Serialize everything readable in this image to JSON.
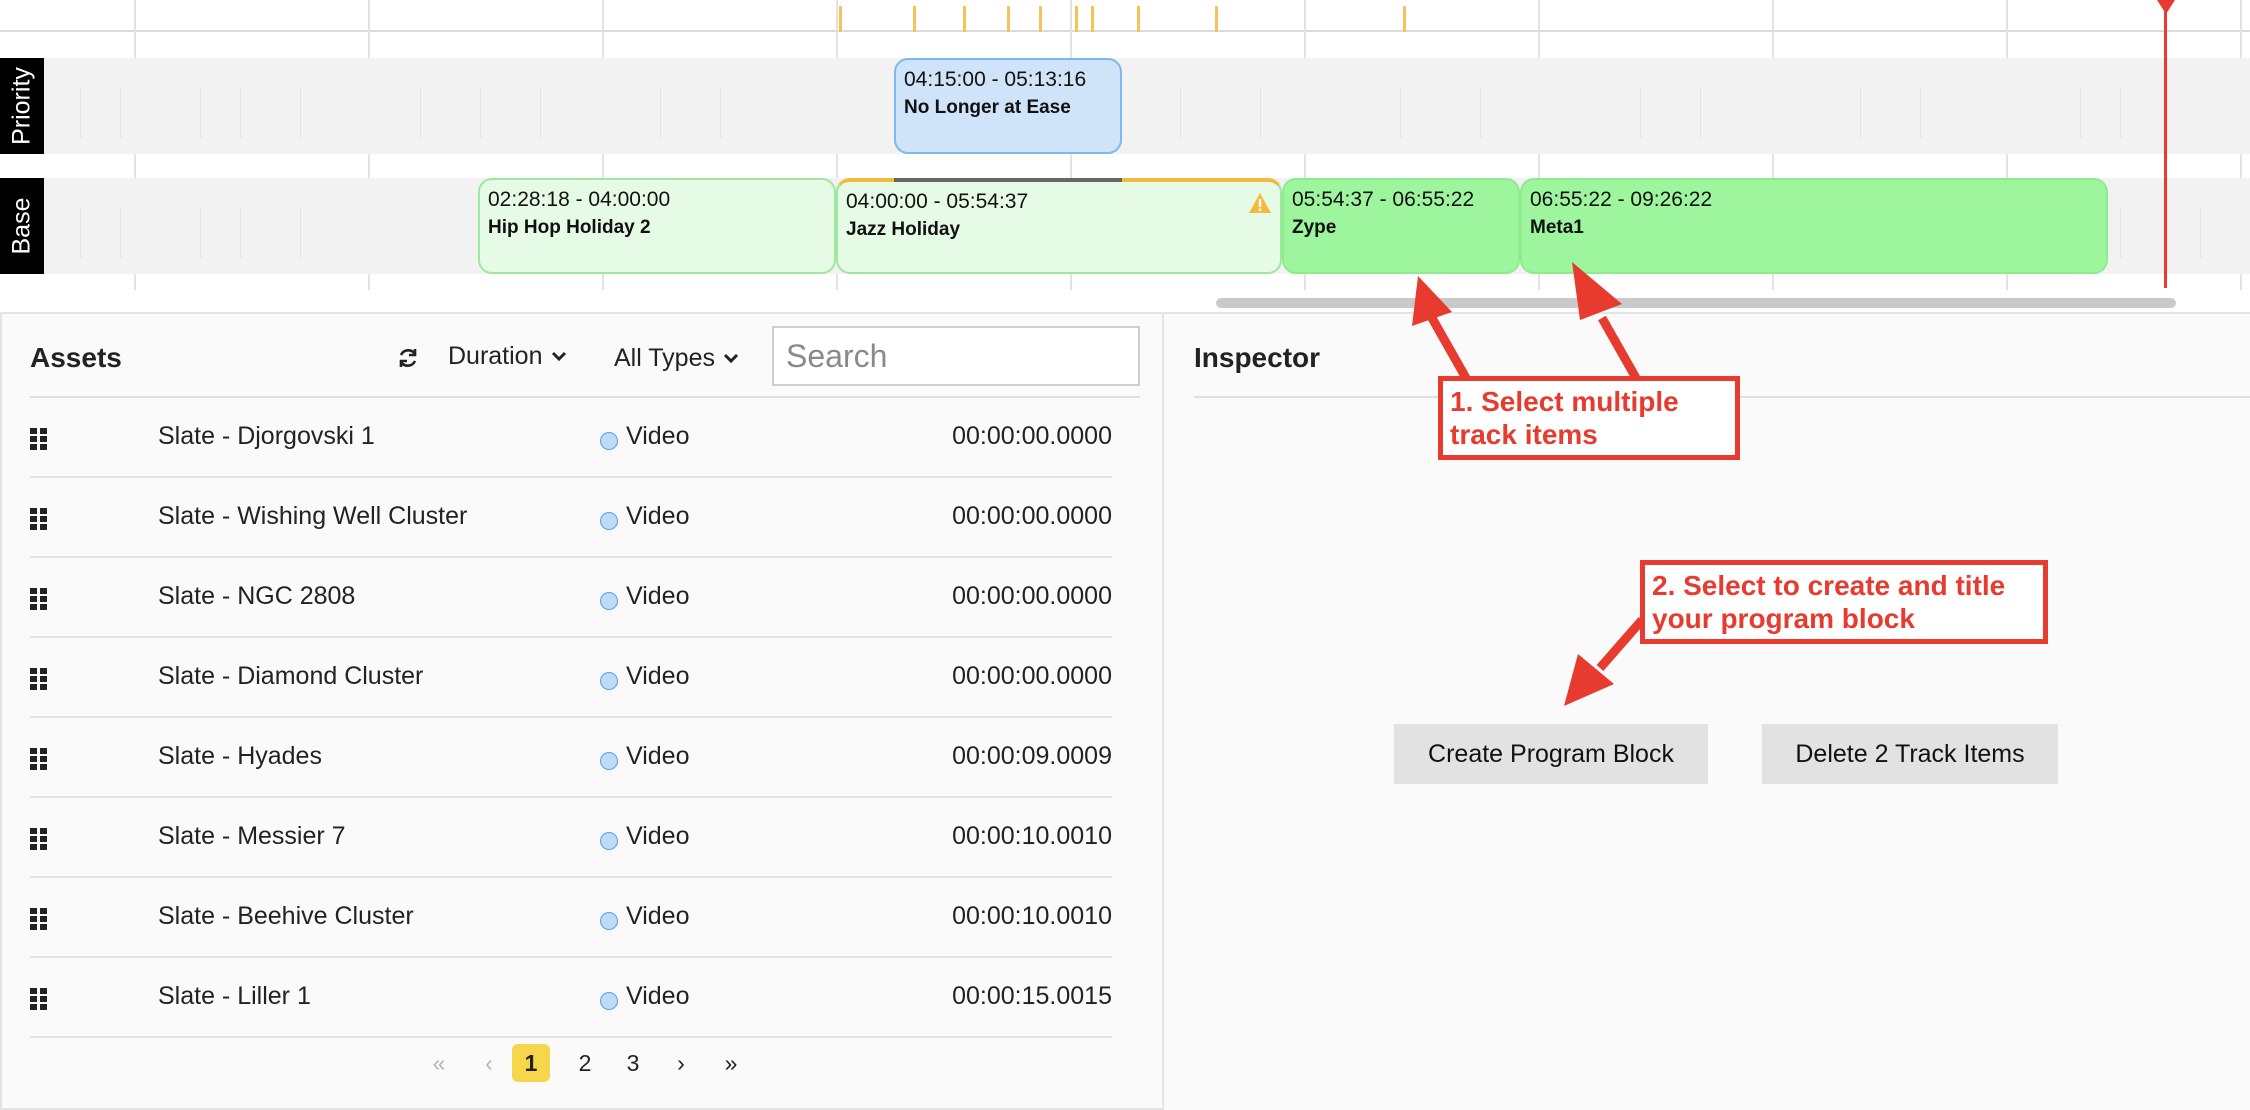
{
  "timeline": {
    "lanes": [
      {
        "id": "priority",
        "label": "Priority"
      },
      {
        "id": "base",
        "label": "Base"
      }
    ],
    "clips": [
      {
        "time": "04:15:00 - 05:13:16",
        "name": "No Longer at Ease"
      },
      {
        "time": "02:28:18 - 04:00:00",
        "name": "Hip Hop Holiday 2"
      },
      {
        "time": "04:00:00 - 05:54:37",
        "name": "Jazz Holiday"
      },
      {
        "time": "05:54:37 - 06:55:22",
        "name": "Zype"
      },
      {
        "time": "06:55:22 - 09:26:22",
        "name": "Meta1"
      }
    ]
  },
  "assets": {
    "title": "Assets",
    "sort_label": "Duration",
    "type_filter": "All Types",
    "search_placeholder": "Search",
    "rows": [
      {
        "name": "Slate - Djorgovski 1",
        "type": "Video",
        "duration": "00:00:00.0000"
      },
      {
        "name": "Slate - Wishing Well Cluster",
        "type": "Video",
        "duration": "00:00:00.0000"
      },
      {
        "name": "Slate - NGC 2808",
        "type": "Video",
        "duration": "00:00:00.0000"
      },
      {
        "name": "Slate - Diamond Cluster",
        "type": "Video",
        "duration": "00:00:00.0000"
      },
      {
        "name": "Slate - Hyades",
        "type": "Video",
        "duration": "00:00:09.0009"
      },
      {
        "name": "Slate - Messier 7",
        "type": "Video",
        "duration": "00:00:10.0010"
      },
      {
        "name": "Slate - Beehive Cluster",
        "type": "Video",
        "duration": "00:00:10.0010"
      },
      {
        "name": "Slate - Liller 1",
        "type": "Video",
        "duration": "00:00:15.0015"
      }
    ],
    "pagination": {
      "first": "«",
      "prev": "‹",
      "pages": [
        "1",
        "2",
        "3"
      ],
      "current": "1",
      "next": "›",
      "last": "»"
    }
  },
  "inspector": {
    "title": "Inspector",
    "create_button": "Create Program Block",
    "delete_button": "Delete 2 Track Items"
  },
  "annotations": {
    "callout1": "1. Select multiple track items",
    "callout2": "2. Select to create and title your program block"
  },
  "colors": {
    "accent_red": "#e63b2e",
    "clip_green": "#9df59d",
    "clip_light_green": "#e6fbe6",
    "clip_blue": "#cfe3f9",
    "marker_yellow": "#f5c35a",
    "page_active": "#f6d64a"
  }
}
